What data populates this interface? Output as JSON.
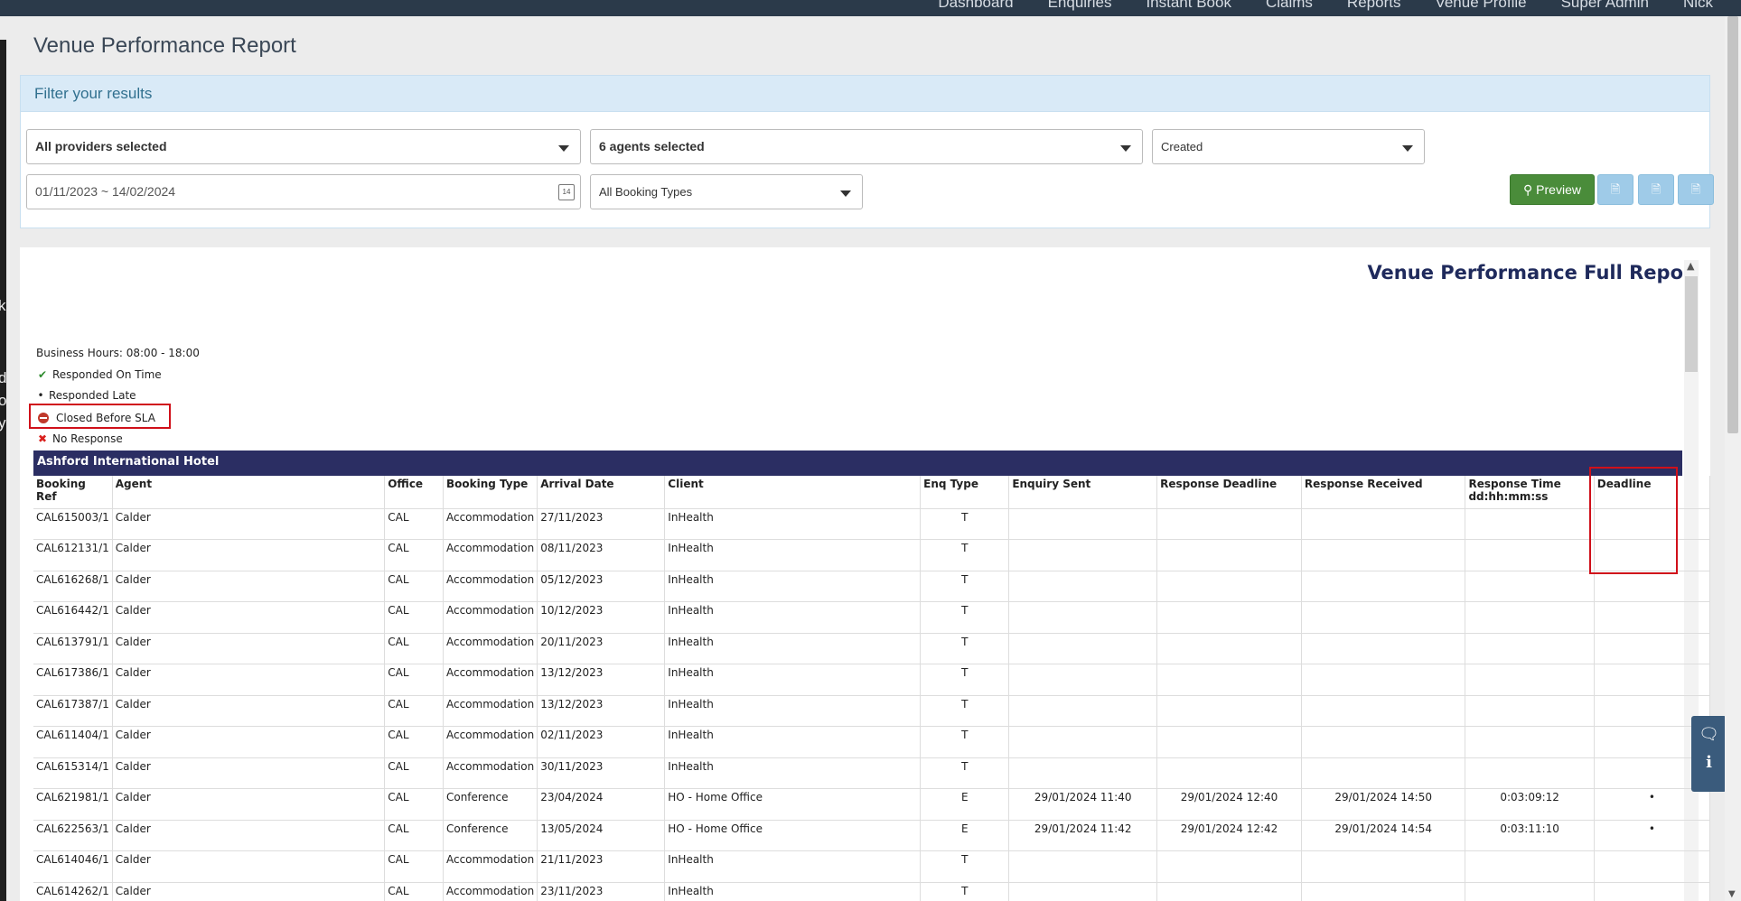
{
  "nav": {
    "items": [
      "Dashboard",
      "Enquiries",
      "Instant Book",
      "Claims",
      "Reports",
      "Venue Profile",
      "Super Admin",
      "Nick"
    ]
  },
  "page_title": "Venue Performance Report",
  "filter": {
    "heading": "Filter your results",
    "providers": "All providers selected",
    "agents": "6 agents selected",
    "date_field": "Created",
    "date_range": "01/11/2023 ~ 14/02/2024",
    "booking_types": "All Booking Types",
    "preview_label": "Preview"
  },
  "report": {
    "title": "Venue Performance Full Repo",
    "business_hours": "Business Hours: 08:00 - 18:00",
    "legend": {
      "on_time": "Responded On Time",
      "late": "Responded Late",
      "closed": "Closed Before SLA",
      "no_response": "No Response"
    },
    "hotel": "Ashford International Hotel",
    "headers": {
      "booking_ref": "Booking Ref",
      "agent": "Agent",
      "office": "Office",
      "booking_type": "Booking Type",
      "arrival_date": "Arrival Date",
      "client": "Client",
      "enq_type": "Enq Type",
      "enquiry_sent": "Enquiry Sent",
      "response_deadline": "Response Deadline",
      "response_received": "Response Received",
      "response_time": "Response Time dd:hh:mm:ss",
      "deadline": "Deadline"
    },
    "rows": [
      {
        "ref": "CAL615003/1",
        "agent": "Calder",
        "office": "CAL",
        "type": "Accommodation",
        "arrival": "27/11/2023",
        "client": "InHealth",
        "enq": "T",
        "sent": "",
        "deadline": "",
        "received": "",
        "time": "",
        "status": ""
      },
      {
        "ref": "CAL612131/1",
        "agent": "Calder",
        "office": "CAL",
        "type": "Accommodation",
        "arrival": "08/11/2023",
        "client": "InHealth",
        "enq": "T",
        "sent": "",
        "deadline": "",
        "received": "",
        "time": "",
        "status": ""
      },
      {
        "ref": "CAL616268/1",
        "agent": "Calder",
        "office": "CAL",
        "type": "Accommodation",
        "arrival": "05/12/2023",
        "client": "InHealth",
        "enq": "T",
        "sent": "",
        "deadline": "",
        "received": "",
        "time": "",
        "status": ""
      },
      {
        "ref": "CAL616442/1",
        "agent": "Calder",
        "office": "CAL",
        "type": "Accommodation",
        "arrival": "10/12/2023",
        "client": "InHealth",
        "enq": "T",
        "sent": "",
        "deadline": "",
        "received": "",
        "time": "",
        "status": ""
      },
      {
        "ref": "CAL613791/1",
        "agent": "Calder",
        "office": "CAL",
        "type": "Accommodation",
        "arrival": "20/11/2023",
        "client": "InHealth",
        "enq": "T",
        "sent": "",
        "deadline": "",
        "received": "",
        "time": "",
        "status": ""
      },
      {
        "ref": "CAL617386/1",
        "agent": "Calder",
        "office": "CAL",
        "type": "Accommodation",
        "arrival": "13/12/2023",
        "client": "InHealth",
        "enq": "T",
        "sent": "",
        "deadline": "",
        "received": "",
        "time": "",
        "status": ""
      },
      {
        "ref": "CAL617387/1",
        "agent": "Calder",
        "office": "CAL",
        "type": "Accommodation",
        "arrival": "13/12/2023",
        "client": "InHealth",
        "enq": "T",
        "sent": "",
        "deadline": "",
        "received": "",
        "time": "",
        "status": ""
      },
      {
        "ref": "CAL611404/1",
        "agent": "Calder",
        "office": "CAL",
        "type": "Accommodation",
        "arrival": "02/11/2023",
        "client": "InHealth",
        "enq": "T",
        "sent": "",
        "deadline": "",
        "received": "",
        "time": "",
        "status": ""
      },
      {
        "ref": "CAL615314/1",
        "agent": "Calder",
        "office": "CAL",
        "type": "Accommodation",
        "arrival": "30/11/2023",
        "client": "InHealth",
        "enq": "T",
        "sent": "",
        "deadline": "",
        "received": "",
        "time": "",
        "status": ""
      },
      {
        "ref": "CAL621981/1",
        "agent": "Calder",
        "office": "CAL",
        "type": "Conference",
        "arrival": "23/04/2024",
        "client": "HO - Home Office",
        "enq": "E",
        "sent": "29/01/2024 11:40",
        "deadline": "29/01/2024 12:40",
        "received": "29/01/2024 14:50",
        "time": "0:03:09:12",
        "status": "•"
      },
      {
        "ref": "CAL622563/1",
        "agent": "Calder",
        "office": "CAL",
        "type": "Conference",
        "arrival": "13/05/2024",
        "client": "HO - Home Office",
        "enq": "E",
        "sent": "29/01/2024 11:42",
        "deadline": "29/01/2024 12:42",
        "received": "29/01/2024 14:54",
        "time": "0:03:11:10",
        "status": "•"
      },
      {
        "ref": "CAL614046/1",
        "agent": "Calder",
        "office": "CAL",
        "type": "Accommodation",
        "arrival": "21/11/2023",
        "client": "InHealth",
        "enq": "T",
        "sent": "",
        "deadline": "",
        "received": "",
        "time": "",
        "status": ""
      },
      {
        "ref": "CAL614262/1",
        "agent": "Calder",
        "office": "CAL",
        "type": "Accommodation",
        "arrival": "23/11/2023",
        "client": "InHealth",
        "enq": "T",
        "sent": "",
        "deadline": "",
        "received": "",
        "time": "",
        "status": ""
      }
    ]
  },
  "colors": {
    "nav_bg": "#2b3a4a",
    "hotel_bar": "#2b2e63",
    "preview_btn": "#4a8c3a",
    "highlight": "#d0101a"
  }
}
